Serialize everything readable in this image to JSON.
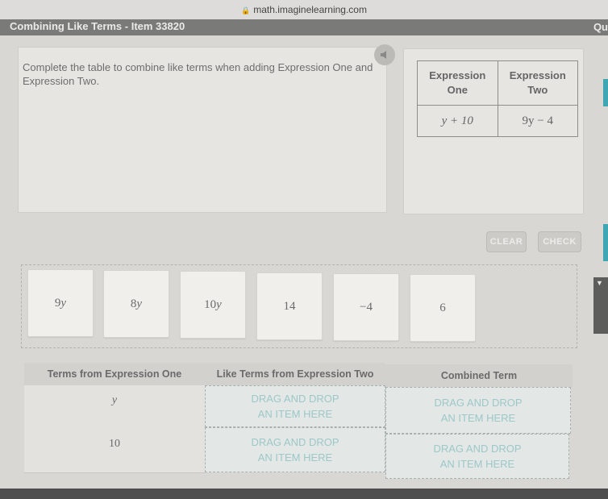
{
  "browser": {
    "url": "math.imaginelearning.com"
  },
  "header": {
    "title": "Combining Like Terms - Item 33820",
    "right_label": "Qu"
  },
  "prompt": {
    "text": "Complete the table to combine like terms when adding Expression One and Expression Two.",
    "audio_icon": "speaker-icon"
  },
  "expression_table": {
    "headers": [
      "Expression One",
      "Expression Two"
    ],
    "values": [
      "y + 10",
      "9y − 4"
    ]
  },
  "buttons": {
    "clear": "CLEAR",
    "check": "CHECK"
  },
  "tiles": [
    "9y",
    "8y",
    "10y",
    "14",
    "−4",
    "6"
  ],
  "work_table": {
    "headers": [
      "Terms from Expression One",
      "Like Terms from Expression Two",
      "Combined Term"
    ],
    "rows": [
      {
        "term": "y",
        "like_placeholder": [
          "DRAG AND DROP",
          "AN ITEM HERE"
        ],
        "combined_placeholder": [
          "DRAG AND DROP",
          "AN ITEM HERE"
        ]
      },
      {
        "term": "10",
        "like_placeholder": [
          "DRAG AND DROP",
          "AN ITEM HERE"
        ],
        "combined_placeholder": [
          "DRAG AND DROP",
          "AN ITEM HERE"
        ]
      }
    ]
  },
  "colors": {
    "accent": "#3fa6b4",
    "drop_text": "#9dc7c9",
    "title_bar": "#7a7b79"
  }
}
